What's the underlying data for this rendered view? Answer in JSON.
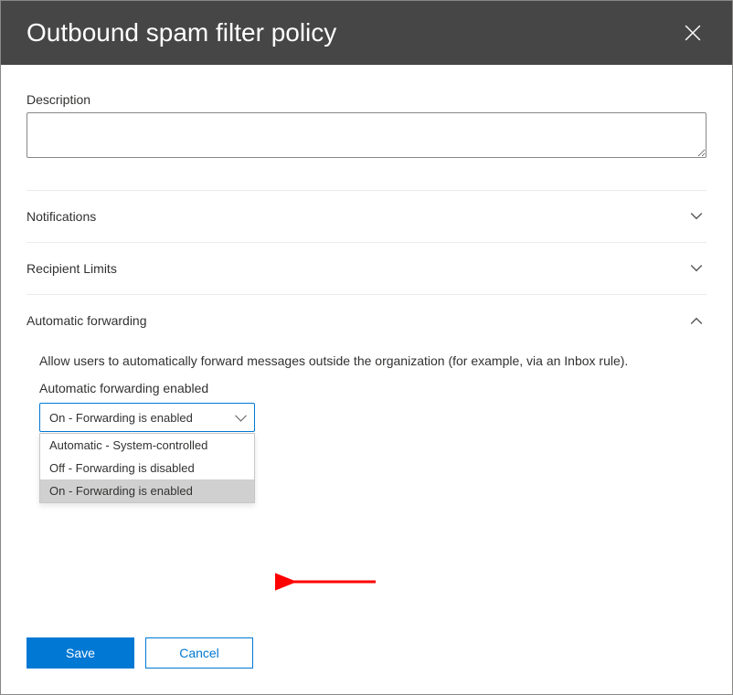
{
  "header": {
    "title": "Outbound spam filter policy"
  },
  "description": {
    "label": "Description",
    "value": ""
  },
  "sections": {
    "notifications": {
      "title": "Notifications"
    },
    "recipient_limits": {
      "title": "Recipient Limits"
    },
    "automatic_forwarding": {
      "title": "Automatic forwarding",
      "description": "Allow users to automatically forward messages outside the organization (for example, via an Inbox rule).",
      "field_label": "Automatic forwarding enabled",
      "selected": "On - Forwarding is enabled",
      "options": [
        "Automatic - System-controlled",
        "Off - Forwarding is disabled",
        "On - Forwarding is enabled"
      ]
    }
  },
  "footer": {
    "save_label": "Save",
    "cancel_label": "Cancel"
  }
}
